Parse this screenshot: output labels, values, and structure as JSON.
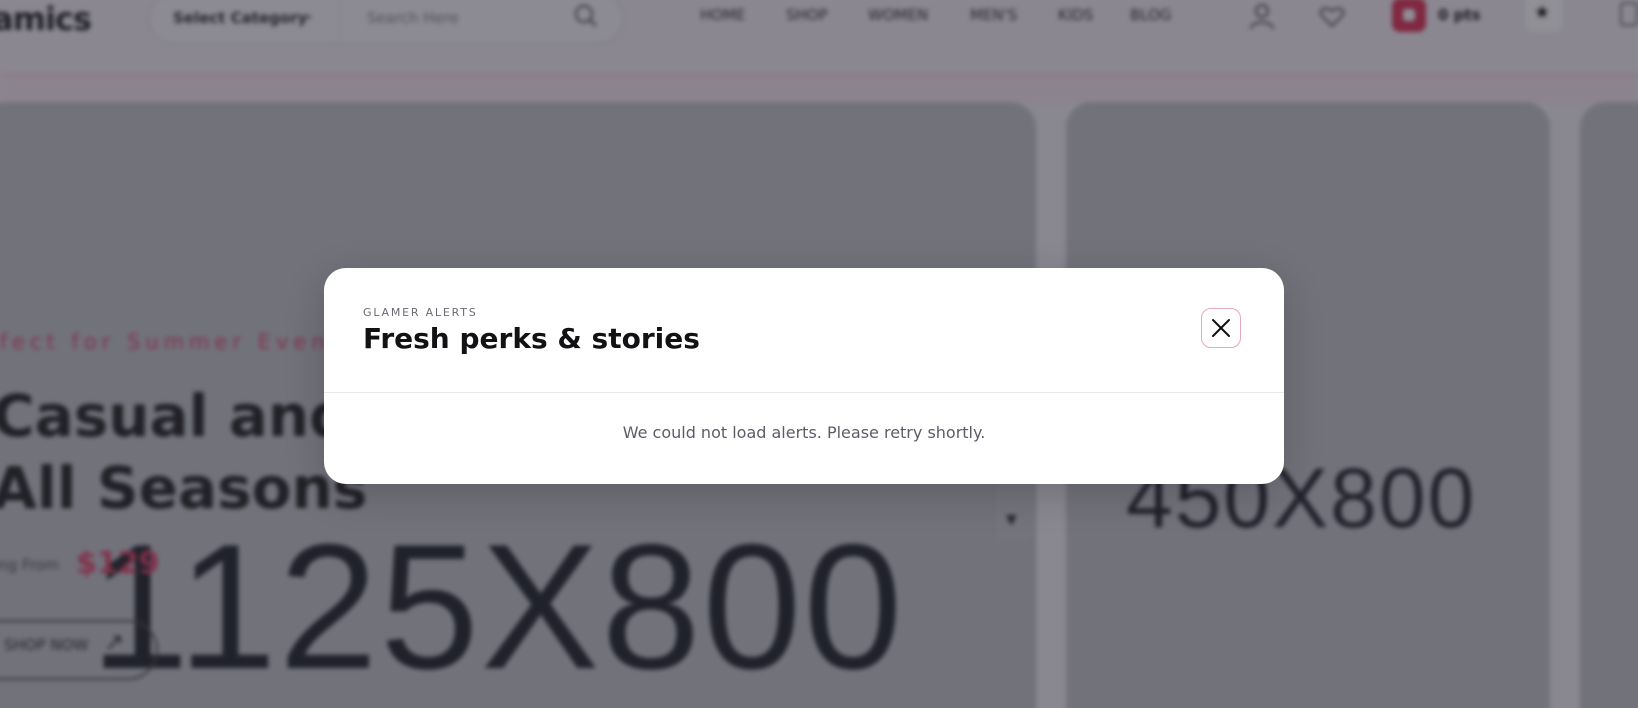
{
  "header": {
    "brand_text": "amics",
    "category_label": "Select Category",
    "search_placeholder": "Search Here",
    "nav": [
      "HOME",
      "SHOP",
      "WOMEN",
      "MEN'S",
      "KIDS",
      "BLOG"
    ],
    "cart_count": "0 pts",
    "accent_color": "#e0395f"
  },
  "hero": {
    "kicker": "rfect for Summer Eveni",
    "title_line1": "Casual and S",
    "title_line2": "All Seasons",
    "price_prefix": "ing From",
    "price": "$129",
    "cta_label": "SHOP NOW",
    "placeholder_main": "1125X800",
    "placeholder_side": "450X800"
  },
  "modal": {
    "eyebrow": "GLAMER ALERTS",
    "title": "Fresh perks & stories",
    "message": "We could not load alerts. Please retry shortly.",
    "close_icon": "close-icon",
    "close_border_color": "#e8a6c1"
  }
}
